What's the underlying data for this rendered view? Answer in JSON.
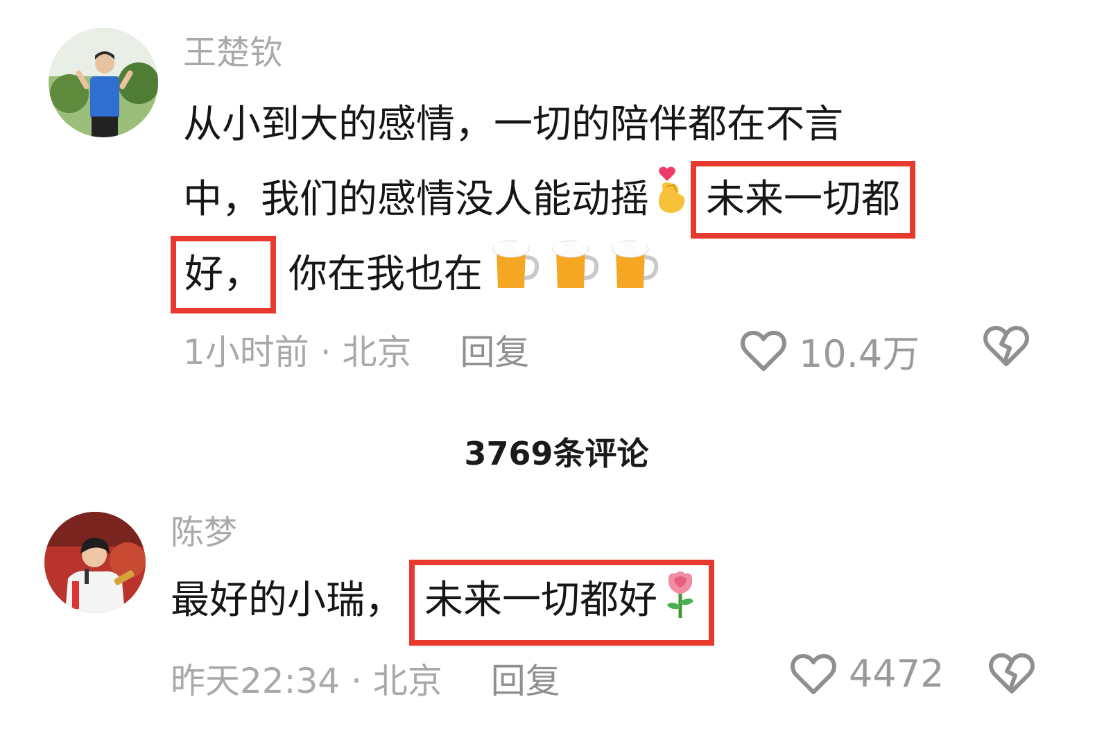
{
  "comments": [
    {
      "username": "王楚钦",
      "lines": [
        "从小到大的感情，一切的陪伴都在不言",
        "中，我们的感情没人能动摇",
        "你在我也在"
      ],
      "highlight_a": "未来一切都",
      "highlight_b": "好，",
      "time": "1小时前 · 北京",
      "reply": "回复",
      "likes": "10.4万",
      "icons": [
        "finger-heart-emoji",
        "beer-mug-emoji",
        "heart-outline",
        "broken-heart"
      ]
    },
    {
      "username": "陈梦",
      "text": "最好的小瑞，",
      "highlight": "未来一切都好",
      "time": "昨天22:34 · 北京",
      "reply": "回复",
      "likes": "4472",
      "icons": [
        "rose-emoji",
        "heart-outline",
        "broken-heart"
      ]
    }
  ],
  "comment_count": "3769条评论",
  "colors": {
    "highlight_box": "#e8392e",
    "meta_text": "#a9a9a9"
  }
}
